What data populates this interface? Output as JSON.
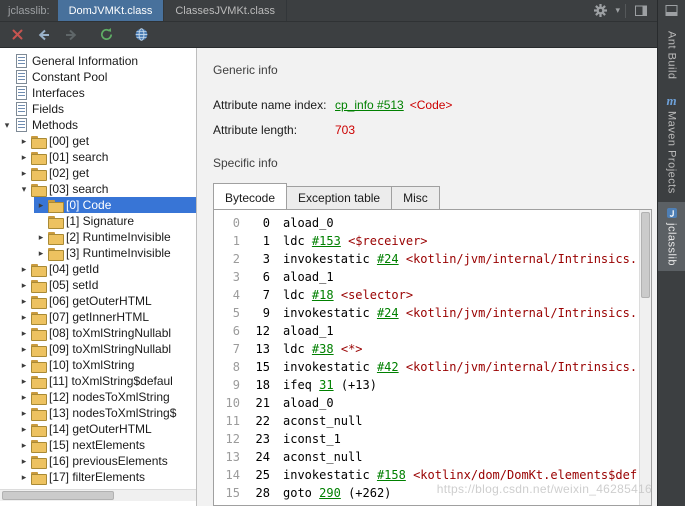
{
  "colors": {
    "dark_bar_bg": "#3c3f41",
    "selected_tab_blue": "#48719c",
    "tree_selection_blue": "#3875d6",
    "link_green": "#008000",
    "value_red": "#cc0000",
    "comment_maroon": "#990000",
    "folder_yellow": "#edc260"
  },
  "tab_bar": {
    "label": "jclasslib:",
    "tabs": [
      {
        "label": "DomJVMKt.class",
        "selected": true
      },
      {
        "label": "ClassesJVMKt.class",
        "selected": false
      }
    ]
  },
  "toolbar": {
    "icons": [
      "close-icon",
      "back-icon",
      "forward-icon",
      "refresh-icon",
      "browser-icon"
    ]
  },
  "tree": {
    "rows": [
      {
        "t": "General Information",
        "icon": "doc",
        "lvl": 0,
        "exp": "none"
      },
      {
        "t": "Constant Pool",
        "icon": "doc",
        "lvl": 0,
        "exp": "none"
      },
      {
        "t": "Interfaces",
        "icon": "doc",
        "lvl": 0,
        "exp": "none"
      },
      {
        "t": "Fields",
        "icon": "doc",
        "lvl": 0,
        "exp": "none"
      },
      {
        "t": "Methods",
        "icon": "doc",
        "lvl": 0,
        "exp": "down"
      },
      {
        "t": "[00] get",
        "icon": "folder",
        "lvl": 1,
        "exp": "right"
      },
      {
        "t": "[01] search",
        "icon": "folder",
        "lvl": 1,
        "exp": "right"
      },
      {
        "t": "[02] get",
        "icon": "folder",
        "lvl": 1,
        "exp": "right"
      },
      {
        "t": "[03] search",
        "icon": "folder",
        "lvl": 1,
        "exp": "down"
      },
      {
        "t": "[0] Code",
        "icon": "folder",
        "lvl": 2,
        "exp": "right",
        "sel": true
      },
      {
        "t": "[1] Signature",
        "icon": "folder",
        "lvl": 2,
        "exp": "none"
      },
      {
        "t": "[2] RuntimeInvisible",
        "icon": "folder",
        "lvl": 2,
        "exp": "right"
      },
      {
        "t": "[3] RuntimeInvisible",
        "icon": "folder",
        "lvl": 2,
        "exp": "right"
      },
      {
        "t": "[04] getId",
        "icon": "folder",
        "lvl": 1,
        "exp": "right"
      },
      {
        "t": "[05] setId",
        "icon": "folder",
        "lvl": 1,
        "exp": "right"
      },
      {
        "t": "[06] getOuterHTML",
        "icon": "folder",
        "lvl": 1,
        "exp": "right"
      },
      {
        "t": "[07] getInnerHTML",
        "icon": "folder",
        "lvl": 1,
        "exp": "right"
      },
      {
        "t": "[08] toXmlStringNullabl",
        "icon": "folder",
        "lvl": 1,
        "exp": "right"
      },
      {
        "t": "[09] toXmlStringNullabl",
        "icon": "folder",
        "lvl": 1,
        "exp": "right"
      },
      {
        "t": "[10] toXmlString",
        "icon": "folder",
        "lvl": 1,
        "exp": "right"
      },
      {
        "t": "[11] toXmlString$defaul",
        "icon": "folder",
        "lvl": 1,
        "exp": "right"
      },
      {
        "t": "[12] nodesToXmlString",
        "icon": "folder",
        "lvl": 1,
        "exp": "right"
      },
      {
        "t": "[13] nodesToXmlString$",
        "icon": "folder",
        "lvl": 1,
        "exp": "right"
      },
      {
        "t": "[14] getOuterHTML",
        "icon": "folder",
        "lvl": 1,
        "exp": "right"
      },
      {
        "t": "[15] nextElements",
        "icon": "folder",
        "lvl": 1,
        "exp": "right"
      },
      {
        "t": "[16] previousElements",
        "icon": "folder",
        "lvl": 1,
        "exp": "right"
      },
      {
        "t": "[17] filterElements",
        "icon": "folder",
        "lvl": 1,
        "exp": "right"
      }
    ]
  },
  "detail": {
    "generic_header": "Generic info",
    "fields": [
      {
        "label": "Attribute name index:",
        "link": "cp_info #513",
        "annotation": "<Code>"
      },
      {
        "label": "Attribute length:",
        "value": "703"
      }
    ],
    "specific_header": "Specific info",
    "tabs": [
      {
        "label": "Bytecode",
        "selected": true
      },
      {
        "label": "Exception table",
        "selected": false
      },
      {
        "label": "Misc",
        "selected": false
      }
    ],
    "bytecode": [
      {
        "num": "0",
        "off": "0",
        "parts": [
          {
            "t": "mn",
            "s": "aload_0"
          }
        ]
      },
      {
        "num": "1",
        "off": "1",
        "parts": [
          {
            "t": "mn",
            "s": "ldc"
          },
          {
            "t": "link",
            "s": "#153"
          },
          {
            "t": "cmt",
            "s": "<$receiver>"
          }
        ]
      },
      {
        "num": "2",
        "off": "3",
        "parts": [
          {
            "t": "mn",
            "s": "invokestatic"
          },
          {
            "t": "link",
            "s": "#24"
          },
          {
            "t": "cmt",
            "s": "<kotlin/jvm/internal/Intrinsics.chec"
          }
        ]
      },
      {
        "num": "3",
        "off": "6",
        "parts": [
          {
            "t": "mn",
            "s": "aload_1"
          }
        ]
      },
      {
        "num": "4",
        "off": "7",
        "parts": [
          {
            "t": "mn",
            "s": "ldc"
          },
          {
            "t": "link",
            "s": "#18"
          },
          {
            "t": "cmt",
            "s": "<selector>"
          }
        ]
      },
      {
        "num": "5",
        "off": "9",
        "parts": [
          {
            "t": "mn",
            "s": "invokestatic"
          },
          {
            "t": "link",
            "s": "#24"
          },
          {
            "t": "cmt",
            "s": "<kotlin/jvm/internal/Intrinsics.chec"
          }
        ]
      },
      {
        "num": "6",
        "off": "12",
        "parts": [
          {
            "t": "mn",
            "s": "aload_1"
          }
        ]
      },
      {
        "num": "7",
        "off": "13",
        "parts": [
          {
            "t": "mn",
            "s": "ldc"
          },
          {
            "t": "link",
            "s": "#38"
          },
          {
            "t": "cmt",
            "s": "<*>"
          }
        ]
      },
      {
        "num": "8",
        "off": "15",
        "parts": [
          {
            "t": "mn",
            "s": "invokestatic"
          },
          {
            "t": "link",
            "s": "#42"
          },
          {
            "t": "cmt",
            "s": "<kotlin/jvm/internal/Intrinsics.areE"
          }
        ]
      },
      {
        "num": "9",
        "off": "18",
        "parts": [
          {
            "t": "mn",
            "s": "ifeq"
          },
          {
            "t": "link",
            "s": "31"
          },
          {
            "t": "plain",
            "s": "(+13)"
          }
        ]
      },
      {
        "num": "10",
        "off": "21",
        "parts": [
          {
            "t": "mn",
            "s": "aload_0"
          }
        ]
      },
      {
        "num": "11",
        "off": "22",
        "parts": [
          {
            "t": "mn",
            "s": "aconst_null"
          }
        ]
      },
      {
        "num": "12",
        "off": "23",
        "parts": [
          {
            "t": "mn",
            "s": "iconst_1"
          }
        ]
      },
      {
        "num": "13",
        "off": "24",
        "parts": [
          {
            "t": "mn",
            "s": "aconst_null"
          }
        ]
      },
      {
        "num": "14",
        "off": "25",
        "parts": [
          {
            "t": "mn",
            "s": "invokestatic"
          },
          {
            "t": "link",
            "s": "#158"
          },
          {
            "t": "cmt",
            "s": "<kotlinx/dom/DomKt.elements$default"
          }
        ]
      },
      {
        "num": "15",
        "off": "28",
        "parts": [
          {
            "t": "mn",
            "s": "goto"
          },
          {
            "t": "link",
            "s": "290"
          },
          {
            "t": "plain",
            "s": "(+262)"
          }
        ]
      }
    ]
  },
  "right_strip": {
    "tabs": [
      {
        "label": "Ant Build",
        "selected": false
      },
      {
        "label": "Maven Projects",
        "icon": "maven-m",
        "selected": false
      },
      {
        "label": "jclasslib",
        "icon": "jclasslib",
        "selected": true
      }
    ]
  },
  "watermark": "https://blog.csdn.net/weixin_46285416"
}
